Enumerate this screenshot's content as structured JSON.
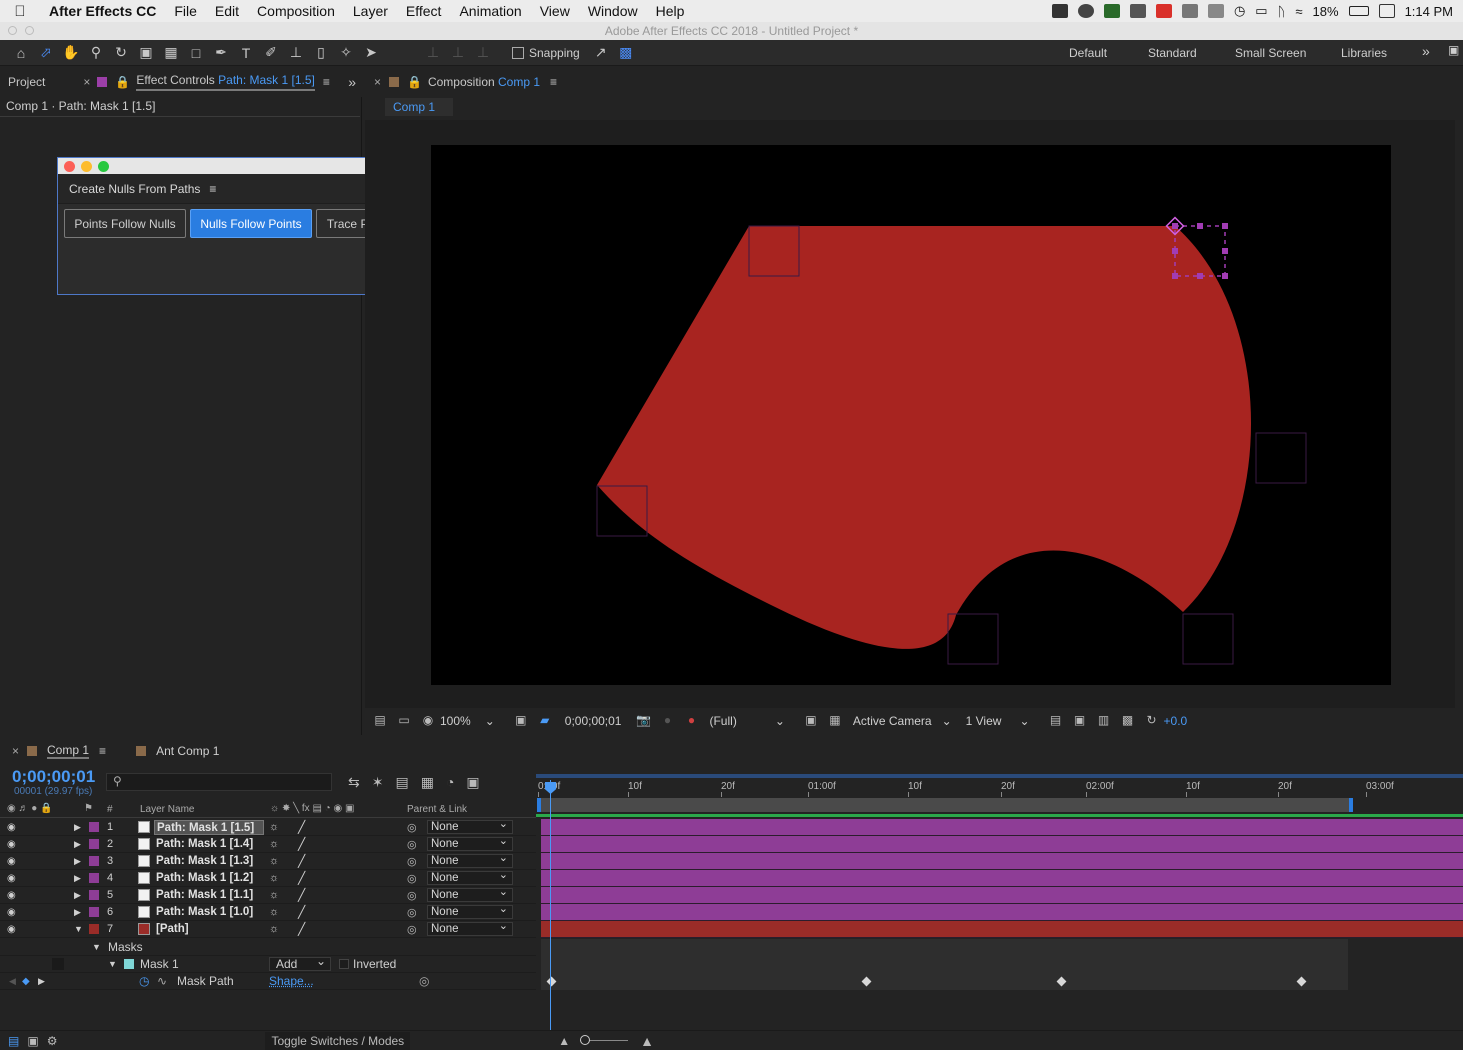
{
  "menubar": {
    "app": "After Effects CC",
    "items": [
      "File",
      "Edit",
      "Composition",
      "Layer",
      "Effect",
      "Animation",
      "View",
      "Window",
      "Help"
    ],
    "battery": "18%",
    "clock": "1:14 PM"
  },
  "window_title": "Adobe After Effects CC 2018 - Untitled Project *",
  "toolbar": {
    "snapping_label": "Snapping",
    "workspaces": [
      "Default",
      "Standard",
      "Small Screen",
      "Libraries"
    ]
  },
  "left_panel": {
    "project_tab": "Project",
    "effect_controls_prefix": "Effect Controls",
    "effect_controls_target": "Path: Mask 1 [1.5]",
    "breadcrumb": "Comp 1 · Path: Mask 1 [1.5]"
  },
  "dialog": {
    "title": "Create Nulls From Paths",
    "buttons": [
      "Points Follow Nulls",
      "Nulls Follow Points",
      "Trace Path"
    ]
  },
  "comp_panel": {
    "tab_prefix": "Composition",
    "tab_name": "Comp 1",
    "subtab": "Comp 1"
  },
  "viewer_bar": {
    "zoom": "100%",
    "timecode": "0;00;00;01",
    "resolution": "(Full)",
    "camera": "Active Camera",
    "view": "1 View",
    "exposure": "+0.0"
  },
  "colors": {
    "shape_fill": "#a82420",
    "layer_purple": "#8e3d96",
    "path_red": "#9a2c28",
    "accent_blue": "#2a7de1"
  },
  "timeline": {
    "tabs": [
      "Comp 1",
      "Ant Comp 1"
    ],
    "timecode": "0;00;00;01",
    "frame_info": "00001 (29.97 fps)",
    "header_hash": "#",
    "header_layer_name": "Layer Name",
    "header_parent": "Parent & Link",
    "ruler": [
      "0:00f",
      "10f",
      "20f",
      "01:00f",
      "10f",
      "20f",
      "02:00f",
      "10f",
      "20f",
      "03:00f"
    ],
    "layers": [
      {
        "num": "1",
        "name": "Path: Mask 1 [1.5]",
        "parent": "None"
      },
      {
        "num": "2",
        "name": "Path: Mask 1 [1.4]",
        "parent": "None"
      },
      {
        "num": "3",
        "name": "Path: Mask 1 [1.3]",
        "parent": "None"
      },
      {
        "num": "4",
        "name": "Path: Mask 1 [1.2]",
        "parent": "None"
      },
      {
        "num": "5",
        "name": "Path: Mask 1 [1.1]",
        "parent": "None"
      },
      {
        "num": "6",
        "name": "Path: Mask 1 [1.0]",
        "parent": "None"
      },
      {
        "num": "7",
        "name": "[Path]",
        "parent": "None"
      }
    ],
    "masks_label": "Masks",
    "mask1_label": "Mask 1",
    "mask_mode": "Add",
    "inverted_label": "Inverted",
    "mask_path_label": "Mask Path",
    "mask_path_value": "Shape...",
    "toggle_label": "Toggle Switches / Modes"
  }
}
